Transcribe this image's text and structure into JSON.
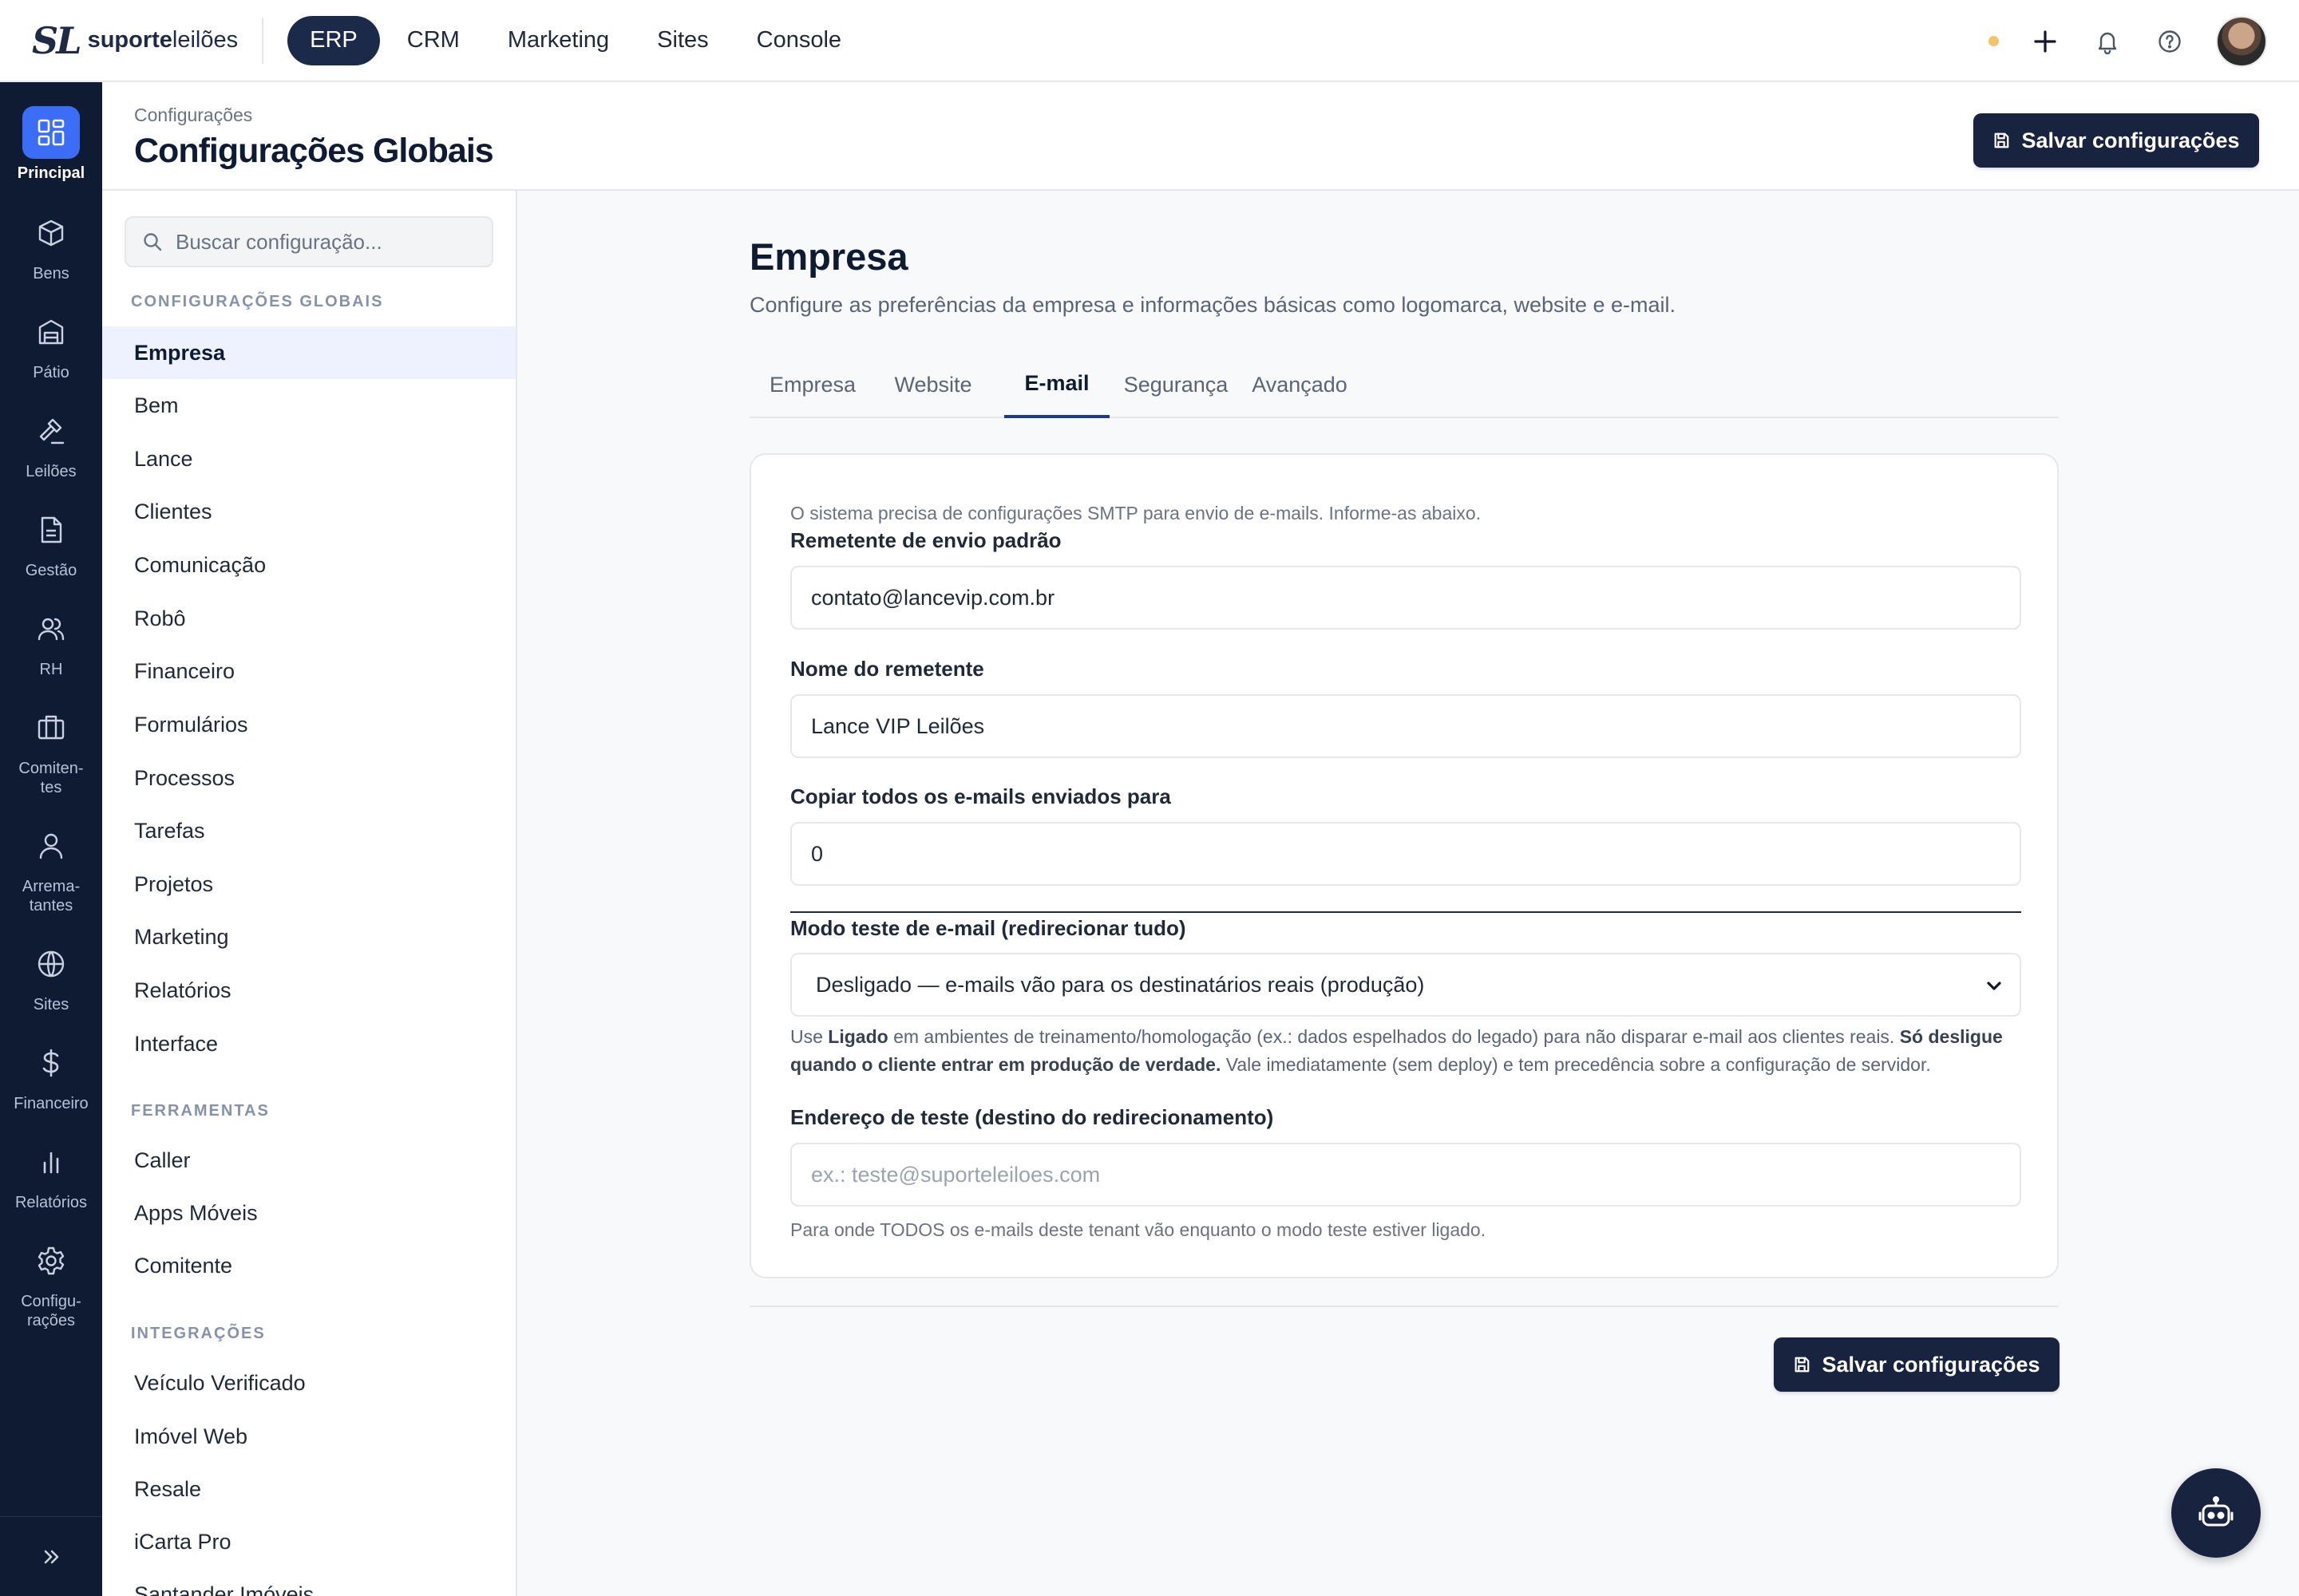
{
  "brand": {
    "mark": "SL",
    "name_bold": "suporte",
    "name_light": "leilões"
  },
  "topnav": [
    {
      "label": "ERP",
      "active": true
    },
    {
      "label": "CRM"
    },
    {
      "label": "Marketing"
    },
    {
      "label": "Sites"
    },
    {
      "label": "Console"
    }
  ],
  "topbar_icons": [
    "status-dot",
    "plus-icon",
    "bell-icon",
    "help-icon",
    "avatar"
  ],
  "rail": [
    {
      "label": "Principal",
      "icon": "grid-icon",
      "active": true
    },
    {
      "label": "Bens",
      "icon": "box-icon"
    },
    {
      "label": "Pátio",
      "icon": "warehouse-icon"
    },
    {
      "label": "Leilões",
      "icon": "gavel-icon"
    },
    {
      "label": "Gestão",
      "icon": "document-icon"
    },
    {
      "label": "RH",
      "icon": "users-icon"
    },
    {
      "label": "Comiten-\ntes",
      "icon": "briefcase-icon"
    },
    {
      "label": "Arrema-\ntantes",
      "icon": "user-icon"
    },
    {
      "label": "Sites",
      "icon": "globe-icon"
    },
    {
      "label": "Financeiro",
      "icon": "dollar-icon"
    },
    {
      "label": "Relatórios",
      "icon": "bar-chart-icon"
    },
    {
      "label": "Configu-\nrações",
      "icon": "gear-icon"
    }
  ],
  "header": {
    "breadcrumb": "Configurações",
    "title": "Configurações Globais",
    "save_label": "Salvar configurações"
  },
  "sidebar": {
    "search_placeholder": "Buscar configuração...",
    "groups": [
      {
        "title": "CONFIGURAÇÕES GLOBAIS",
        "items": [
          "Empresa",
          "Bem",
          "Lance",
          "Clientes",
          "Comunicação",
          "Robô",
          "Financeiro",
          "Formulários",
          "Processos",
          "Tarefas",
          "Projetos",
          "Marketing",
          "Relatórios",
          "Interface"
        ]
      },
      {
        "title": "FERRAMENTAS",
        "items": [
          "Caller",
          "Apps Móveis",
          "Comitente"
        ]
      },
      {
        "title": "INTEGRAÇÕES",
        "items": [
          "Veículo Verificado",
          "Imóvel Web",
          "Resale",
          "iCarta Pro",
          "Santander Imóveis"
        ]
      }
    ],
    "active_item": "Empresa"
  },
  "main": {
    "title": "Empresa",
    "subtitle": "Configure as preferências da empresa e informações básicas como logomarca, website e e-mail.",
    "tabs": [
      "Empresa",
      "Website",
      "E-mail",
      "Segurança",
      "Avançado"
    ],
    "active_tab": "E-mail",
    "smtp_hint": "O sistema precisa de configurações SMTP para envio de e-mails. Informe-as abaixo.",
    "fields": {
      "sender_email_label": "Remetente de envio padrão",
      "sender_email_value": "contato@lancevip.com.br",
      "sender_name_label": "Nome do remetente",
      "sender_name_value": "Lance VIP Leilões",
      "copy_label": "Copiar todos os e-mails enviados para",
      "copy_value": "0",
      "test_mode_label": "Modo teste de e-mail (redirecionar tudo)",
      "test_mode_value": "Desligado — e-mails vão para os destinatários reais (produção)",
      "test_mode_note": {
        "p1": "Use ",
        "b1": "Ligado",
        "p2": " em ambientes de treinamento/homologação (ex.: dados espelhados do legado) para não disparar e-mail aos clientes reais. ",
        "b2": "Só desligue quando o cliente entrar em produção de verdade.",
        "p3": " Vale imediatamente (sem deploy) e tem precedência sobre a configuração de servidor."
      },
      "test_address_label": "Endereço de teste (destino do redirecionamento)",
      "test_address_placeholder": "ex.: teste@suporteleiloes.com",
      "test_address_note": "Para onde TODOS os e-mails deste tenant vão enquanto o modo teste estiver ligado."
    },
    "save_label": "Salvar configurações"
  },
  "colors": {
    "navy": "#0f1b33",
    "accent": "#3b6df6",
    "button": "#17233f",
    "status_dot": "#f6c26b"
  }
}
